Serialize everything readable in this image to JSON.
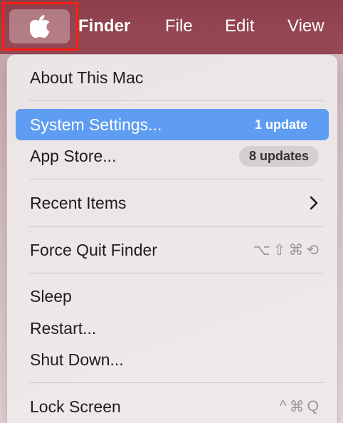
{
  "menubar": {
    "apple_icon": "apple-icon",
    "items": [
      "Finder",
      "File",
      "Edit",
      "View"
    ]
  },
  "menu": {
    "about": "About This Mac",
    "system_settings": {
      "label": "System Settings...",
      "badge": "1 update"
    },
    "app_store": {
      "label": "App Store...",
      "badge": "8 updates"
    },
    "recent_items": {
      "label": "Recent Items",
      "icon": "chevron-right-icon"
    },
    "force_quit": {
      "label": "Force Quit Finder",
      "shortcut": [
        "⌥",
        "⇧",
        "⌘",
        "⟲"
      ]
    },
    "sleep": "Sleep",
    "restart": "Restart...",
    "shut_down": "Shut Down...",
    "lock_screen": {
      "label": "Lock Screen",
      "shortcut": [
        "^",
        "⌘",
        "Q"
      ]
    }
  },
  "colors": {
    "menubar": "#9a4a57",
    "highlight": "#5f9df2",
    "focus_outline": "#ff1e0e"
  }
}
